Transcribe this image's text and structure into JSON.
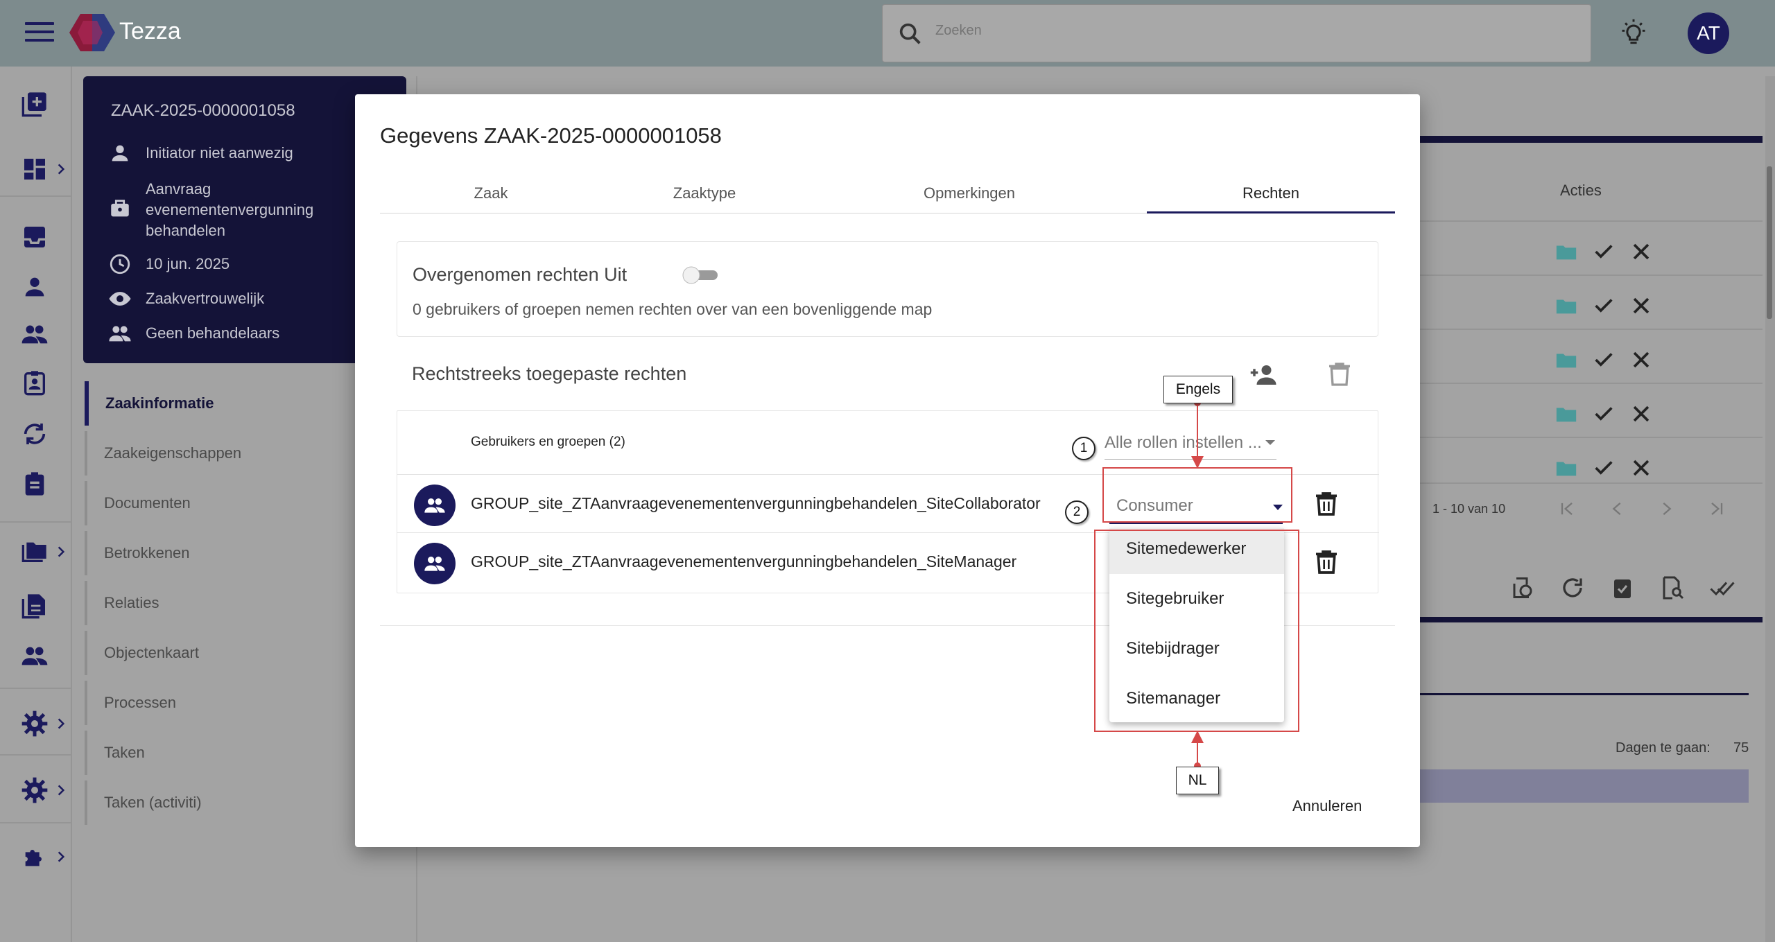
{
  "app": {
    "title": "Tezza",
    "user_initials": "AT"
  },
  "search": {
    "placeholder": "Zoeken"
  },
  "case": {
    "id": "ZAAK-2025-0000001058",
    "initiator": "Initiator niet aanwezig",
    "zaaktype": "Aanvraag evenementenvergunning behandelen",
    "date": "10 jun. 2025",
    "confidentiality": "Zaakvertrouwelijk",
    "handlers": "Geen behandelaars"
  },
  "sidenav": {
    "items": [
      {
        "label": "Zaakinformatie"
      },
      {
        "label": "Zaakeigenschappen"
      },
      {
        "label": "Documenten"
      },
      {
        "label": "Betrokkenen"
      },
      {
        "label": "Relaties"
      },
      {
        "label": "Objectenkaart"
      },
      {
        "label": "Processen"
      },
      {
        "label": "Taken"
      },
      {
        "label": "Taken (activiti)"
      }
    ]
  },
  "background": {
    "acties_header": "Acties",
    "pager": "1 - 10 van 10",
    "dagen_label": "Dagen te gaan:",
    "dagen_value": "75"
  },
  "modal": {
    "title": "Gegevens ZAAK-2025-0000001058",
    "tabs": [
      {
        "label": "Zaak"
      },
      {
        "label": "Zaaktype"
      },
      {
        "label": "Opmerkingen"
      },
      {
        "label": "Rechten"
      }
    ],
    "inherited": {
      "title": "Overgenomen rechten Uit",
      "description": "0 gebruikers of groepen nemen rechten over van een bovenliggende map"
    },
    "direct": {
      "title": "Rechtstreeks toegepaste rechten"
    },
    "table": {
      "header_users": "Gebruikers en groepen (2)",
      "all_roles": "Alle rollen instellen ...",
      "rows": [
        {
          "name": "GROUP_site_ZTAanvraagevenementenvergunningbehandelen_SiteCollaborator",
          "role": "Consumer"
        },
        {
          "name": "GROUP_site_ZTAanvraagevenementenvergunningbehandelen_SiteManager"
        }
      ]
    },
    "dropdown_options": [
      "Sitemedewerker",
      "Sitegebruiker",
      "Sitebijdrager",
      "Sitemanager"
    ],
    "cancel": "Annuleren"
  },
  "annotations": {
    "callout_top": "Engels",
    "callout_bottom": "NL",
    "step1": "1",
    "step2": "2",
    "color": "#d54848"
  },
  "colors": {
    "brand": "#1b1a5c",
    "teal": "#4a9a9a"
  }
}
